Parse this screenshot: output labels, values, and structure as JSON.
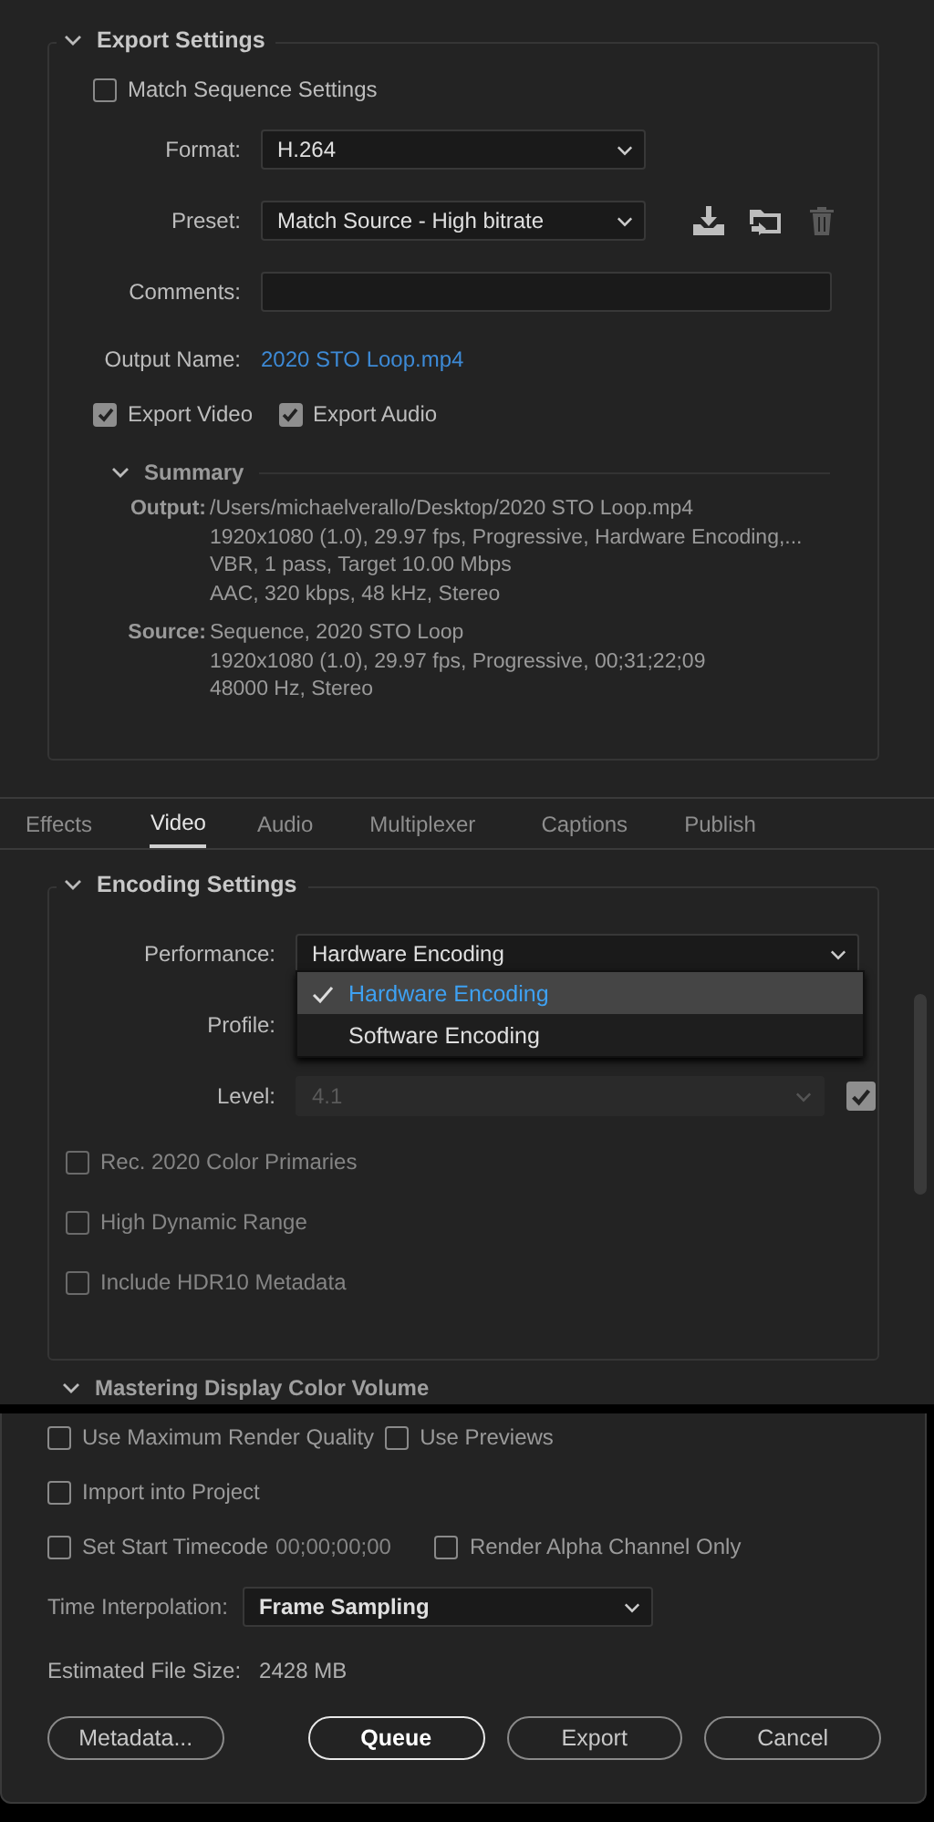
{
  "export_settings": {
    "title": "Export Settings",
    "expanded": true,
    "match_sequence": {
      "label": "Match Sequence Settings",
      "checked": false
    },
    "format": {
      "label": "Format:",
      "value": "H.264"
    },
    "preset": {
      "label": "Preset:",
      "value": "Match Source - High bitrate"
    },
    "comments": {
      "label": "Comments:"
    },
    "output_name": {
      "label": "Output Name:",
      "value": "2020 STO Loop.mp4"
    },
    "exports": [
      {
        "label": "Export Video",
        "checked": true
      },
      {
        "label": "Export Audio",
        "checked": true
      }
    ],
    "summary": {
      "title": "Summary",
      "expanded": true,
      "groups": [
        {
          "label": "Output:",
          "lines": [
            "/Users/michaelverallo/Desktop/2020 STO Loop.mp4",
            "1920x1080 (1.0), 29.97 fps, Progressive, Hardware Encoding,...",
            "VBR, 1 pass, Target 10.00 Mbps",
            "AAC, 320 kbps, 48 kHz, Stereo"
          ]
        },
        {
          "label": "Source:",
          "lines": [
            "Sequence, 2020 STO Loop",
            "1920x1080 (1.0), 29.97 fps, Progressive, 00;31;22;09",
            "48000 Hz, Stereo"
          ]
        }
      ]
    }
  },
  "tabs": [
    {
      "label": "Effects",
      "selected": false
    },
    {
      "label": "Video",
      "selected": true
    },
    {
      "label": "Audio",
      "selected": false
    },
    {
      "label": "Multiplexer",
      "selected": false
    },
    {
      "label": "Captions",
      "selected": false
    },
    {
      "label": "Publish",
      "selected": false
    }
  ],
  "encoding_settings": {
    "title": "Encoding Settings",
    "expanded": true,
    "performance": {
      "label": "Performance:",
      "value": "Hardware Encoding",
      "menu": [
        {
          "label": "Hardware Encoding",
          "selected": true
        },
        {
          "label": "Software Encoding",
          "selected": false
        }
      ]
    },
    "profile": {
      "label": "Profile:"
    },
    "level": {
      "label": "Level:",
      "value": "4.1",
      "disabled": true,
      "checked": true
    },
    "options": [
      {
        "label": "Rec. 2020 Color Primaries",
        "checked": false,
        "disabled": true
      },
      {
        "label": "High Dynamic Range",
        "checked": false,
        "disabled": true
      },
      {
        "label": "Include HDR10 Metadata",
        "checked": false,
        "disabled": true
      }
    ]
  },
  "next_section": {
    "title": "Mastering Display Color Volume",
    "expanded": true
  },
  "footer": {
    "max_render_quality": {
      "label": "Use Maximum Render Quality",
      "checked": false
    },
    "use_previews": {
      "label": "Use Previews",
      "checked": false
    },
    "import_into_project": {
      "label": "Import into Project",
      "checked": false
    },
    "start_timecode": {
      "label": "Set Start Timecode",
      "checked": false,
      "value": "00;00;00;00"
    },
    "render_alpha": {
      "label": "Render Alpha Channel Only",
      "checked": false
    },
    "time_interpolation": {
      "label": "Time Interpolation:",
      "value": "Frame Sampling"
    },
    "file_size": {
      "label": "Estimated File Size:",
      "value": "2428 MB"
    },
    "buttons": [
      {
        "label": "Metadata...",
        "kind": "secondary"
      },
      {
        "label": "Queue",
        "kind": "primary"
      },
      {
        "label": "Export",
        "kind": "secondary"
      },
      {
        "label": "Cancel",
        "kind": "secondary"
      }
    ]
  }
}
